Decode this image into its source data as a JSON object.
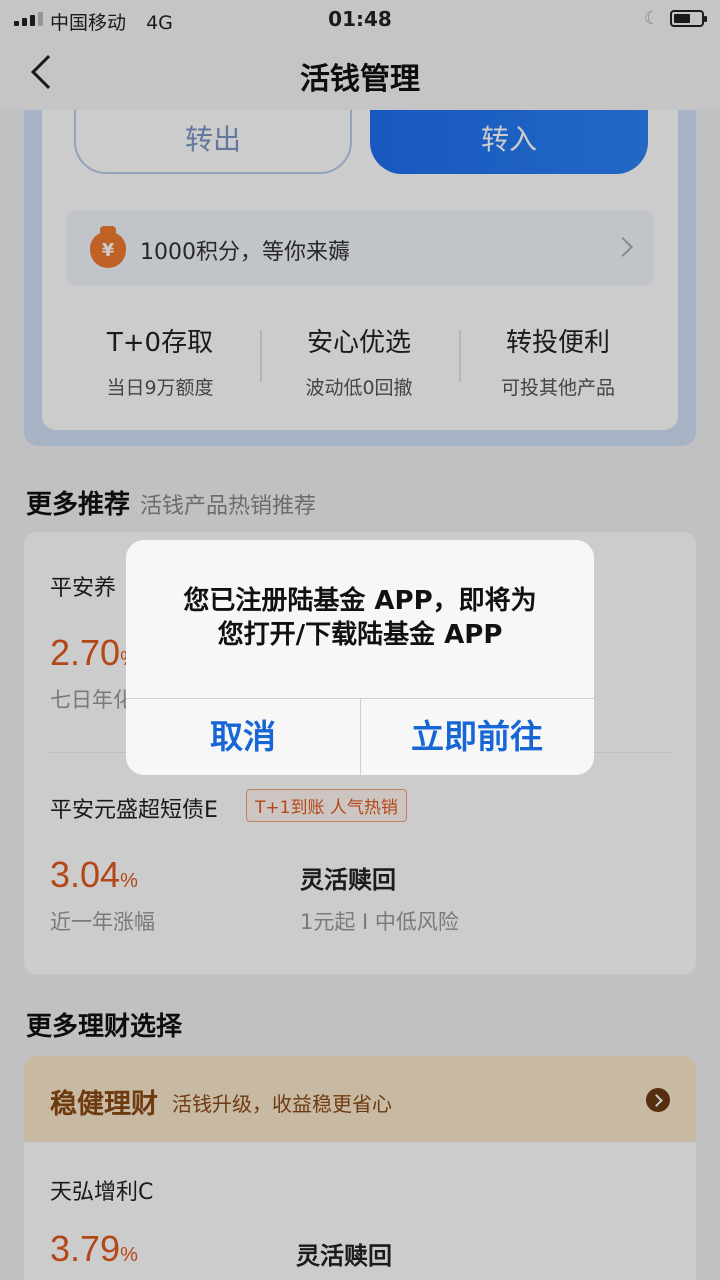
{
  "status_bar": {
    "carrier": "中国移动",
    "network": "4G",
    "time": "01:48"
  },
  "nav": {
    "title": "活钱管理"
  },
  "actions": {
    "out_label": "转出",
    "in_label": "转入"
  },
  "points_banner": {
    "icon": "money-bag-icon",
    "icon_glyph": "¥",
    "text": "1000积分，等你来薅"
  },
  "features": [
    {
      "title": "T+0存取",
      "sub": "当日9万额度"
    },
    {
      "title": "安心优选",
      "sub": "波动低0回撤"
    },
    {
      "title": "转投便利",
      "sub": "可投其他产品"
    }
  ],
  "recommend": {
    "title": "更多推荐",
    "subtitle": "活钱产品热销推荐",
    "products": [
      {
        "name": "平安养",
        "rate": "2.70",
        "unit": "%",
        "rate_label": "七日年化"
      },
      {
        "name": "平安元盛超短债E",
        "tag": "T+1到账 人气热销",
        "rate": "3.04",
        "unit": "%",
        "rate_label": "近一年涨幅",
        "feature": "灵活赎回",
        "meta": "1元起 I 中低风险"
      }
    ]
  },
  "finance": {
    "title": "更多理财选择",
    "header_title": "稳健理财",
    "header_sub": "活钱升级，收益稳更省心",
    "products": [
      {
        "name": "天弘增利C",
        "rate": "3.79",
        "unit": "%",
        "feature": "灵活赎回"
      }
    ]
  },
  "dialog": {
    "line1": "您已注册陆基金 APP，即将为",
    "line2": "您打开/下载陆基金 APP",
    "cancel_label": "取消",
    "confirm_label": "立即前往"
  },
  "colors": {
    "accent_blue": "#1e6ff0",
    "rate_orange": "#e2591f",
    "dialog_blue": "#1766d6"
  }
}
